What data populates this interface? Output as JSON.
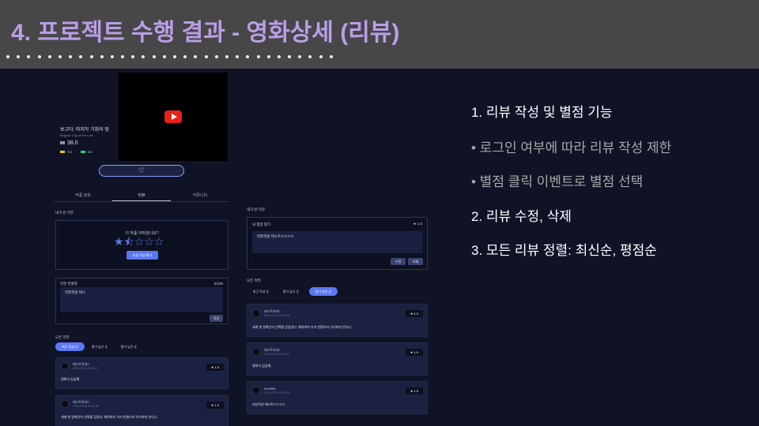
{
  "slide": {
    "title": "4. 프로젝트 수행 결과 - 영화상세 (리뷰)"
  },
  "app": {
    "movie_title": "보고타: 마지막 기회의 땅",
    "movie_subtitle": "Bogota: City of the Lost",
    "overall_rating": "38.0",
    "mini_rating_1": "7.8",
    "mini_rating_2": "0.0",
    "heart_glyph": "♡",
    "tabs": [
      "작품 정보",
      "리뷰",
      "커뮤니티"
    ],
    "my_review_label": "내가 쓴 리뷰",
    "rate_question": "이 작품 어떠셨나요?",
    "star_glyphs": "★⯪☆☆☆",
    "write_button": "리뷰 작성 평가",
    "review_content_label": "리뷰 한줄평",
    "char_count": "0/100",
    "editor_text": "리뷰작성 테스",
    "submit_button": "작성",
    "all_reviews_label": "모든 리뷰",
    "sort_chips_left": [
      "최근 작성 순",
      "평가 높은 순",
      "평가 낮은 순"
    ],
    "left_reviews": [
      {
        "user": "테스트유저2",
        "date": "2024-07-09 04:21:17",
        "score": "1.5",
        "text": "영화가 심심해..."
      },
      {
        "user": "테스트유저2",
        "date": "2024-07-09 04:21:46",
        "score": "1.0",
        "text": "세계 첫 영화인의 선택을 믿었다. 해외까지 가서 만들어서 아기까지 안다니"
      }
    ],
    "right_my_review_label": "내가 쓴 리뷰",
    "my_score_label": "내 별점 평가",
    "my_score": "1.5",
    "my_review_text": "리뷰작성 테스트ㅁㅁㅁㅁ",
    "edit_button": "수정",
    "delete_button": "삭제",
    "right_all_reviews_label": "모든 리뷰",
    "sort_chips_right": [
      "최근 작성 순",
      "평가 높은 순",
      "평가 낮은 순"
    ],
    "right_reviews": [
      {
        "user": "테스트유저2",
        "date": "2024-07-09 04:21:46",
        "score": "1.0",
        "text": "세계 첫 영화인의 선택을 믿었었다. 해외까지 가서 만들어서 아기까지 안다니"
      },
      {
        "user": "테스트유저2",
        "date": "2024-07-09 04:21:17",
        "score": "1.5",
        "text": "영화가 심심해..."
      },
      {
        "user": "hont066",
        "date": "2024-07-09 04:17:30",
        "score": "1.5",
        "text": "리뷰작성 테스트ㅁㅁㅁㅁ"
      }
    ]
  },
  "right_list": {
    "items": [
      {
        "text": "1.  리뷰 작성 및 별점 기능"
      },
      {
        "text": "•     로그인 여부에 따라 리뷰 작성 제한"
      },
      {
        "text": "•     별점 클릭 이벤트로 별점 선택"
      },
      {
        "text": "2.   리뷰 수정, 삭제"
      },
      {
        "text": "3.   모든 리뷰 정렬: 최신순, 평점순"
      }
    ]
  },
  "colors": {
    "accent": "#5b78f3",
    "title": "#b99ee8",
    "header_bg": "#474747",
    "page_bg": "#101326"
  }
}
